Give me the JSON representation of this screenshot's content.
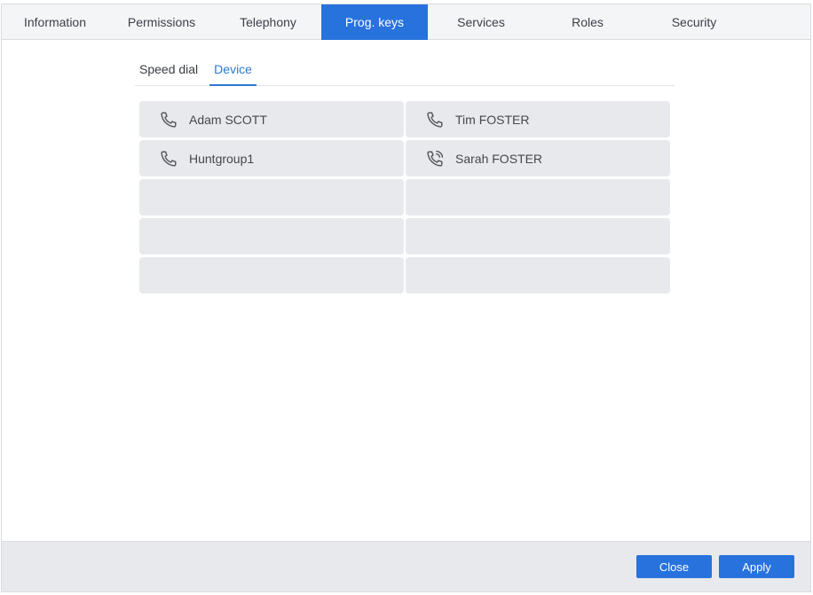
{
  "tabs": [
    {
      "label": "Information"
    },
    {
      "label": "Permissions"
    },
    {
      "label": "Telephony"
    },
    {
      "label": "Prog. keys",
      "active": true
    },
    {
      "label": "Services"
    },
    {
      "label": "Roles"
    },
    {
      "label": "Security"
    }
  ],
  "sub_tabs": [
    {
      "label": "Speed dial"
    },
    {
      "label": "Device",
      "active": true
    }
  ],
  "keys": [
    {
      "label": "Adam SCOTT",
      "icon": "phone-icon"
    },
    {
      "label": "Tim FOSTER",
      "icon": "phone-icon"
    },
    {
      "label": "Huntgroup1",
      "icon": "phone-icon"
    },
    {
      "label": "Sarah FOSTER",
      "icon": "phone-ringing-icon"
    },
    {
      "label": ""
    },
    {
      "label": ""
    },
    {
      "label": ""
    },
    {
      "label": ""
    },
    {
      "label": ""
    },
    {
      "label": ""
    }
  ],
  "footer": {
    "close_label": "Close",
    "apply_label": "Apply"
  },
  "colors": {
    "accent": "#2872dd",
    "key_bg": "#e8e9ec",
    "sub_tab_active": "#2a7ad6"
  }
}
